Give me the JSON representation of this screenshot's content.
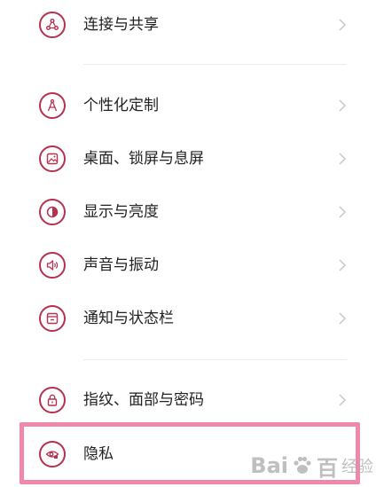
{
  "menu": {
    "items": [
      {
        "label": "连接与共享",
        "icon": "share-icon"
      },
      {
        "label": "个性化定制",
        "icon": "compass-icon"
      },
      {
        "label": "桌面、锁屏与息屏",
        "icon": "wallpaper-icon"
      },
      {
        "label": "显示与亮度",
        "icon": "brightness-icon"
      },
      {
        "label": "声音与振动",
        "icon": "speaker-icon"
      },
      {
        "label": "通知与状态栏",
        "icon": "notification-icon"
      },
      {
        "label": "指纹、面部与密码",
        "icon": "lock-icon"
      },
      {
        "label": "隐私",
        "icon": "eye-lock-icon"
      }
    ]
  },
  "watermark": {
    "brand_a": "Bai",
    "brand_b": "百",
    "brand_c": "经验"
  },
  "colors": {
    "accent": "#b5314f",
    "highlight": "#ef88aa",
    "text": "#222222"
  }
}
